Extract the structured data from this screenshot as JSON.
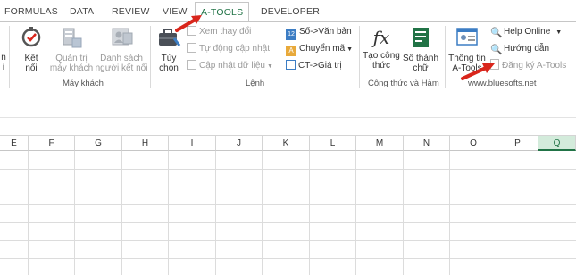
{
  "tabs": [
    {
      "label": "FORMULAS"
    },
    {
      "label": "DATA"
    },
    {
      "label": "REVIEW"
    },
    {
      "label": "VIEW"
    },
    {
      "label": "A-TOOLS",
      "active": true
    },
    {
      "label": "DEVELOPER"
    }
  ],
  "groups": {
    "may_khach": {
      "label": "Máy khách",
      "items": [
        {
          "label": "Kết\nnối",
          "enabled": true
        },
        {
          "label": "Quản trị\nmáy khách",
          "enabled": false
        },
        {
          "label": "Danh sách\nngười kết nối",
          "enabled": false
        }
      ]
    },
    "lenh": {
      "label": "Lệnh",
      "tuy_chon": "Tùy\nchọn",
      "small": [
        {
          "label": "Xem thay đổi",
          "enabled": false
        },
        {
          "label": "Tự động cập nhật",
          "enabled": false
        },
        {
          "label": "Cập nhật dữ liệu",
          "enabled": false
        }
      ],
      "small2": [
        {
          "label": "Số->Văn bản"
        },
        {
          "label": "Chuyển mã"
        },
        {
          "label": "CT->Giá trị"
        }
      ]
    },
    "cong_thuc": {
      "label": "Công thức và Hàm",
      "items": [
        {
          "label": "Tạo công\nthức"
        },
        {
          "label": "Số thành\nchữ"
        }
      ]
    },
    "info": {
      "label": "www.bluesofts.net",
      "thong_tin": "Thông tin\nA-Tools",
      "small": [
        {
          "label": "Help Online",
          "enabled": true
        },
        {
          "label": "Hướng dẫn",
          "enabled": true
        },
        {
          "label": "Đăng ký A-Tools",
          "enabled": false
        }
      ]
    }
  },
  "columns": [
    "E",
    "F",
    "G",
    "H",
    "I",
    "J",
    "K",
    "L",
    "M",
    "N",
    "O",
    "P",
    "Q"
  ],
  "selected_column": "Q",
  "colors": {
    "accent": "#217346",
    "arrow": "#d9261c",
    "selected_header": "#d3ebdb"
  },
  "icons": [
    "connect-icon",
    "server-icon",
    "user-list-icon",
    "briefcase-icon",
    "checkbox-icon",
    "number-text-icon",
    "convert-icon",
    "formula-value-icon",
    "fx-icon",
    "number-word-icon",
    "info-card-icon",
    "help-icon",
    "search-help-icon",
    "register-icon",
    "arrow-icon"
  ]
}
